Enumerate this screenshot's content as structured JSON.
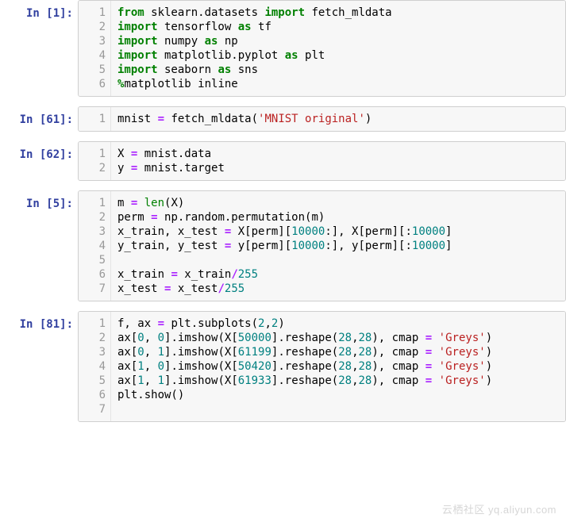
{
  "cells": [
    {
      "prompt": "In [1]:",
      "lines": [
        [
          [
            "kw",
            "from"
          ],
          [
            "nm",
            " sklearn.datasets "
          ],
          [
            "kw",
            "import"
          ],
          [
            "nm",
            " fetch_mldata"
          ]
        ],
        [
          [
            "kw",
            "import"
          ],
          [
            "nm",
            " tensorflow "
          ],
          [
            "kw",
            "as"
          ],
          [
            "nm",
            " tf"
          ]
        ],
        [
          [
            "kw",
            "import"
          ],
          [
            "nm",
            " numpy "
          ],
          [
            "kw",
            "as"
          ],
          [
            "nm",
            " np"
          ]
        ],
        [
          [
            "kw",
            "import"
          ],
          [
            "nm",
            " matplotlib.pyplot "
          ],
          [
            "kw",
            "as"
          ],
          [
            "nm",
            " plt"
          ]
        ],
        [
          [
            "kw",
            "import"
          ],
          [
            "nm",
            " seaborn "
          ],
          [
            "kw",
            "as"
          ],
          [
            "nm",
            " sns"
          ]
        ],
        [
          [
            "mag",
            "%"
          ],
          [
            "nm",
            "matplotlib inline"
          ]
        ]
      ]
    },
    {
      "prompt": "In [61]:",
      "lines": [
        [
          [
            "nm",
            "mnist "
          ],
          [
            "op",
            "="
          ],
          [
            "nm",
            " fetch_mldata("
          ],
          [
            "str",
            "'MNIST original'"
          ],
          [
            "nm",
            ")"
          ]
        ]
      ]
    },
    {
      "prompt": "In [62]:",
      "lines": [
        [
          [
            "nm",
            "X "
          ],
          [
            "op",
            "="
          ],
          [
            "nm",
            " mnist.data"
          ]
        ],
        [
          [
            "nm",
            "y "
          ],
          [
            "op",
            "="
          ],
          [
            "nm",
            " mnist.target"
          ]
        ]
      ]
    },
    {
      "prompt": "In [5]:",
      "lines": [
        [
          [
            "nm",
            "m "
          ],
          [
            "op",
            "="
          ],
          [
            "nm",
            " "
          ],
          [
            "bi",
            "len"
          ],
          [
            "nm",
            "(X)"
          ]
        ],
        [
          [
            "nm",
            "perm "
          ],
          [
            "op",
            "="
          ],
          [
            "nm",
            " np.random.permutation(m)"
          ]
        ],
        [
          [
            "nm",
            "x_train, x_test "
          ],
          [
            "op",
            "="
          ],
          [
            "nm",
            " X[perm]["
          ],
          [
            "num",
            "10000"
          ],
          [
            "nm",
            ":], X[perm][:"
          ],
          [
            "num",
            "10000"
          ],
          [
            "nm",
            "]"
          ]
        ],
        [
          [
            "nm",
            "y_train, y_test "
          ],
          [
            "op",
            "="
          ],
          [
            "nm",
            " y[perm]["
          ],
          [
            "num",
            "10000"
          ],
          [
            "nm",
            ":], y[perm][:"
          ],
          [
            "num",
            "10000"
          ],
          [
            "nm",
            "]"
          ]
        ],
        [
          [
            "nm",
            ""
          ]
        ],
        [
          [
            "nm",
            "x_train "
          ],
          [
            "op",
            "="
          ],
          [
            "nm",
            " x_train"
          ],
          [
            "op",
            "/"
          ],
          [
            "num",
            "255"
          ]
        ],
        [
          [
            "nm",
            "x_test "
          ],
          [
            "op",
            "="
          ],
          [
            "nm",
            " x_test"
          ],
          [
            "op",
            "/"
          ],
          [
            "num",
            "255"
          ]
        ]
      ]
    },
    {
      "prompt": "In [81]:",
      "lines": [
        [
          [
            "nm",
            "f, ax "
          ],
          [
            "op",
            "="
          ],
          [
            "nm",
            " plt.subplots("
          ],
          [
            "num",
            "2"
          ],
          [
            "nm",
            ","
          ],
          [
            "num",
            "2"
          ],
          [
            "nm",
            ")"
          ]
        ],
        [
          [
            "nm",
            "ax["
          ],
          [
            "num",
            "0"
          ],
          [
            "nm",
            ", "
          ],
          [
            "num",
            "0"
          ],
          [
            "nm",
            "].imshow(X["
          ],
          [
            "num",
            "50000"
          ],
          [
            "nm",
            "].reshape("
          ],
          [
            "num",
            "28"
          ],
          [
            "nm",
            ","
          ],
          [
            "num",
            "28"
          ],
          [
            "nm",
            "), cmap "
          ],
          [
            "op",
            "="
          ],
          [
            "nm",
            " "
          ],
          [
            "str",
            "'Greys'"
          ],
          [
            "nm",
            ")"
          ]
        ],
        [
          [
            "nm",
            "ax["
          ],
          [
            "num",
            "0"
          ],
          [
            "nm",
            ", "
          ],
          [
            "num",
            "1"
          ],
          [
            "nm",
            "].imshow(X["
          ],
          [
            "num",
            "61199"
          ],
          [
            "nm",
            "].reshape("
          ],
          [
            "num",
            "28"
          ],
          [
            "nm",
            ","
          ],
          [
            "num",
            "28"
          ],
          [
            "nm",
            "), cmap "
          ],
          [
            "op",
            "="
          ],
          [
            "nm",
            " "
          ],
          [
            "str",
            "'Greys'"
          ],
          [
            "nm",
            ")"
          ]
        ],
        [
          [
            "nm",
            "ax["
          ],
          [
            "num",
            "1"
          ],
          [
            "nm",
            ", "
          ],
          [
            "num",
            "0"
          ],
          [
            "nm",
            "].imshow(X["
          ],
          [
            "num",
            "50420"
          ],
          [
            "nm",
            "].reshape("
          ],
          [
            "num",
            "28"
          ],
          [
            "nm",
            ","
          ],
          [
            "num",
            "28"
          ],
          [
            "nm",
            "), cmap "
          ],
          [
            "op",
            "="
          ],
          [
            "nm",
            " "
          ],
          [
            "str",
            "'Greys'"
          ],
          [
            "nm",
            ")"
          ]
        ],
        [
          [
            "nm",
            "ax["
          ],
          [
            "num",
            "1"
          ],
          [
            "nm",
            ", "
          ],
          [
            "num",
            "1"
          ],
          [
            "nm",
            "].imshow(X["
          ],
          [
            "num",
            "61933"
          ],
          [
            "nm",
            "].reshape("
          ],
          [
            "num",
            "28"
          ],
          [
            "nm",
            ","
          ],
          [
            "num",
            "28"
          ],
          [
            "nm",
            "), cmap "
          ],
          [
            "op",
            "="
          ],
          [
            "nm",
            " "
          ],
          [
            "str",
            "'Greys'"
          ],
          [
            "nm",
            ")"
          ]
        ],
        [
          [
            "nm",
            "plt.show()"
          ]
        ],
        [
          [
            "nm",
            ""
          ]
        ]
      ]
    }
  ],
  "watermark": "云栖社区  yq.aliyun.com"
}
